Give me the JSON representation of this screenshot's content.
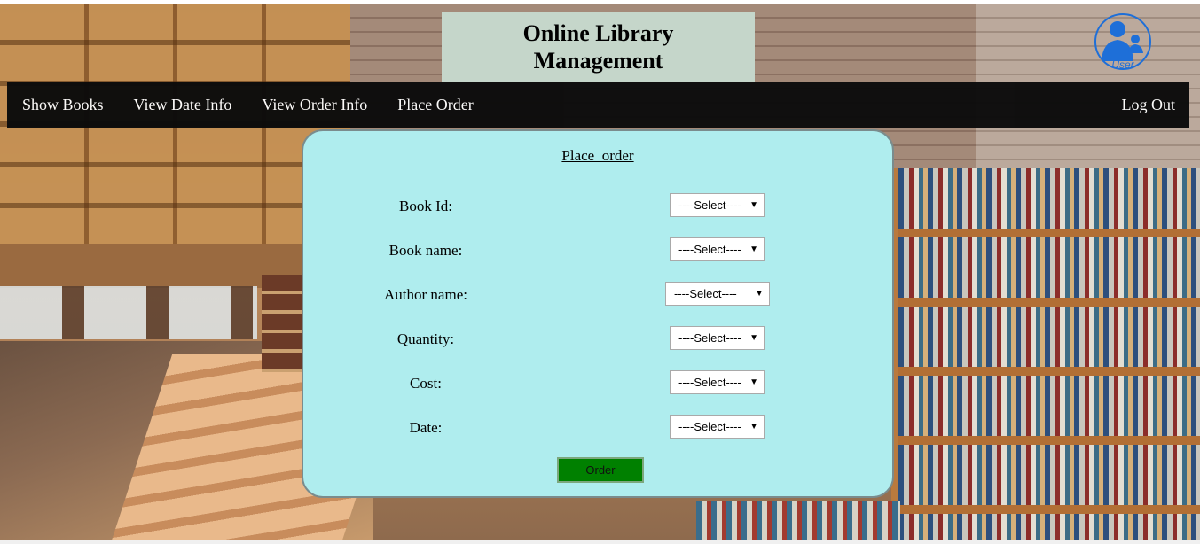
{
  "header": {
    "title": "Online Library\nManagement",
    "user_icon_text": "User"
  },
  "nav": {
    "items": [
      "Show Books",
      "View Date Info",
      "View Order Info",
      "Place Order"
    ],
    "logout": "Log Out"
  },
  "form": {
    "title": "Place_order",
    "fields": [
      {
        "label": "Book Id:",
        "value": "----Select----"
      },
      {
        "label": "Book name:",
        "value": "----Select----"
      },
      {
        "label": "Author name:",
        "value": "----Select----"
      },
      {
        "label": "Quantity:",
        "value": "----Select----"
      },
      {
        "label": "Cost:",
        "value": "----Select----"
      },
      {
        "label": "Date:",
        "value": "----Select----"
      }
    ],
    "submit_label": "Order"
  },
  "colors": {
    "panel": "#afedee",
    "title_box": "#c5d6ca",
    "nav": "#0b0b0b",
    "button": "#008000",
    "user_icon": "#1e6fd8"
  }
}
